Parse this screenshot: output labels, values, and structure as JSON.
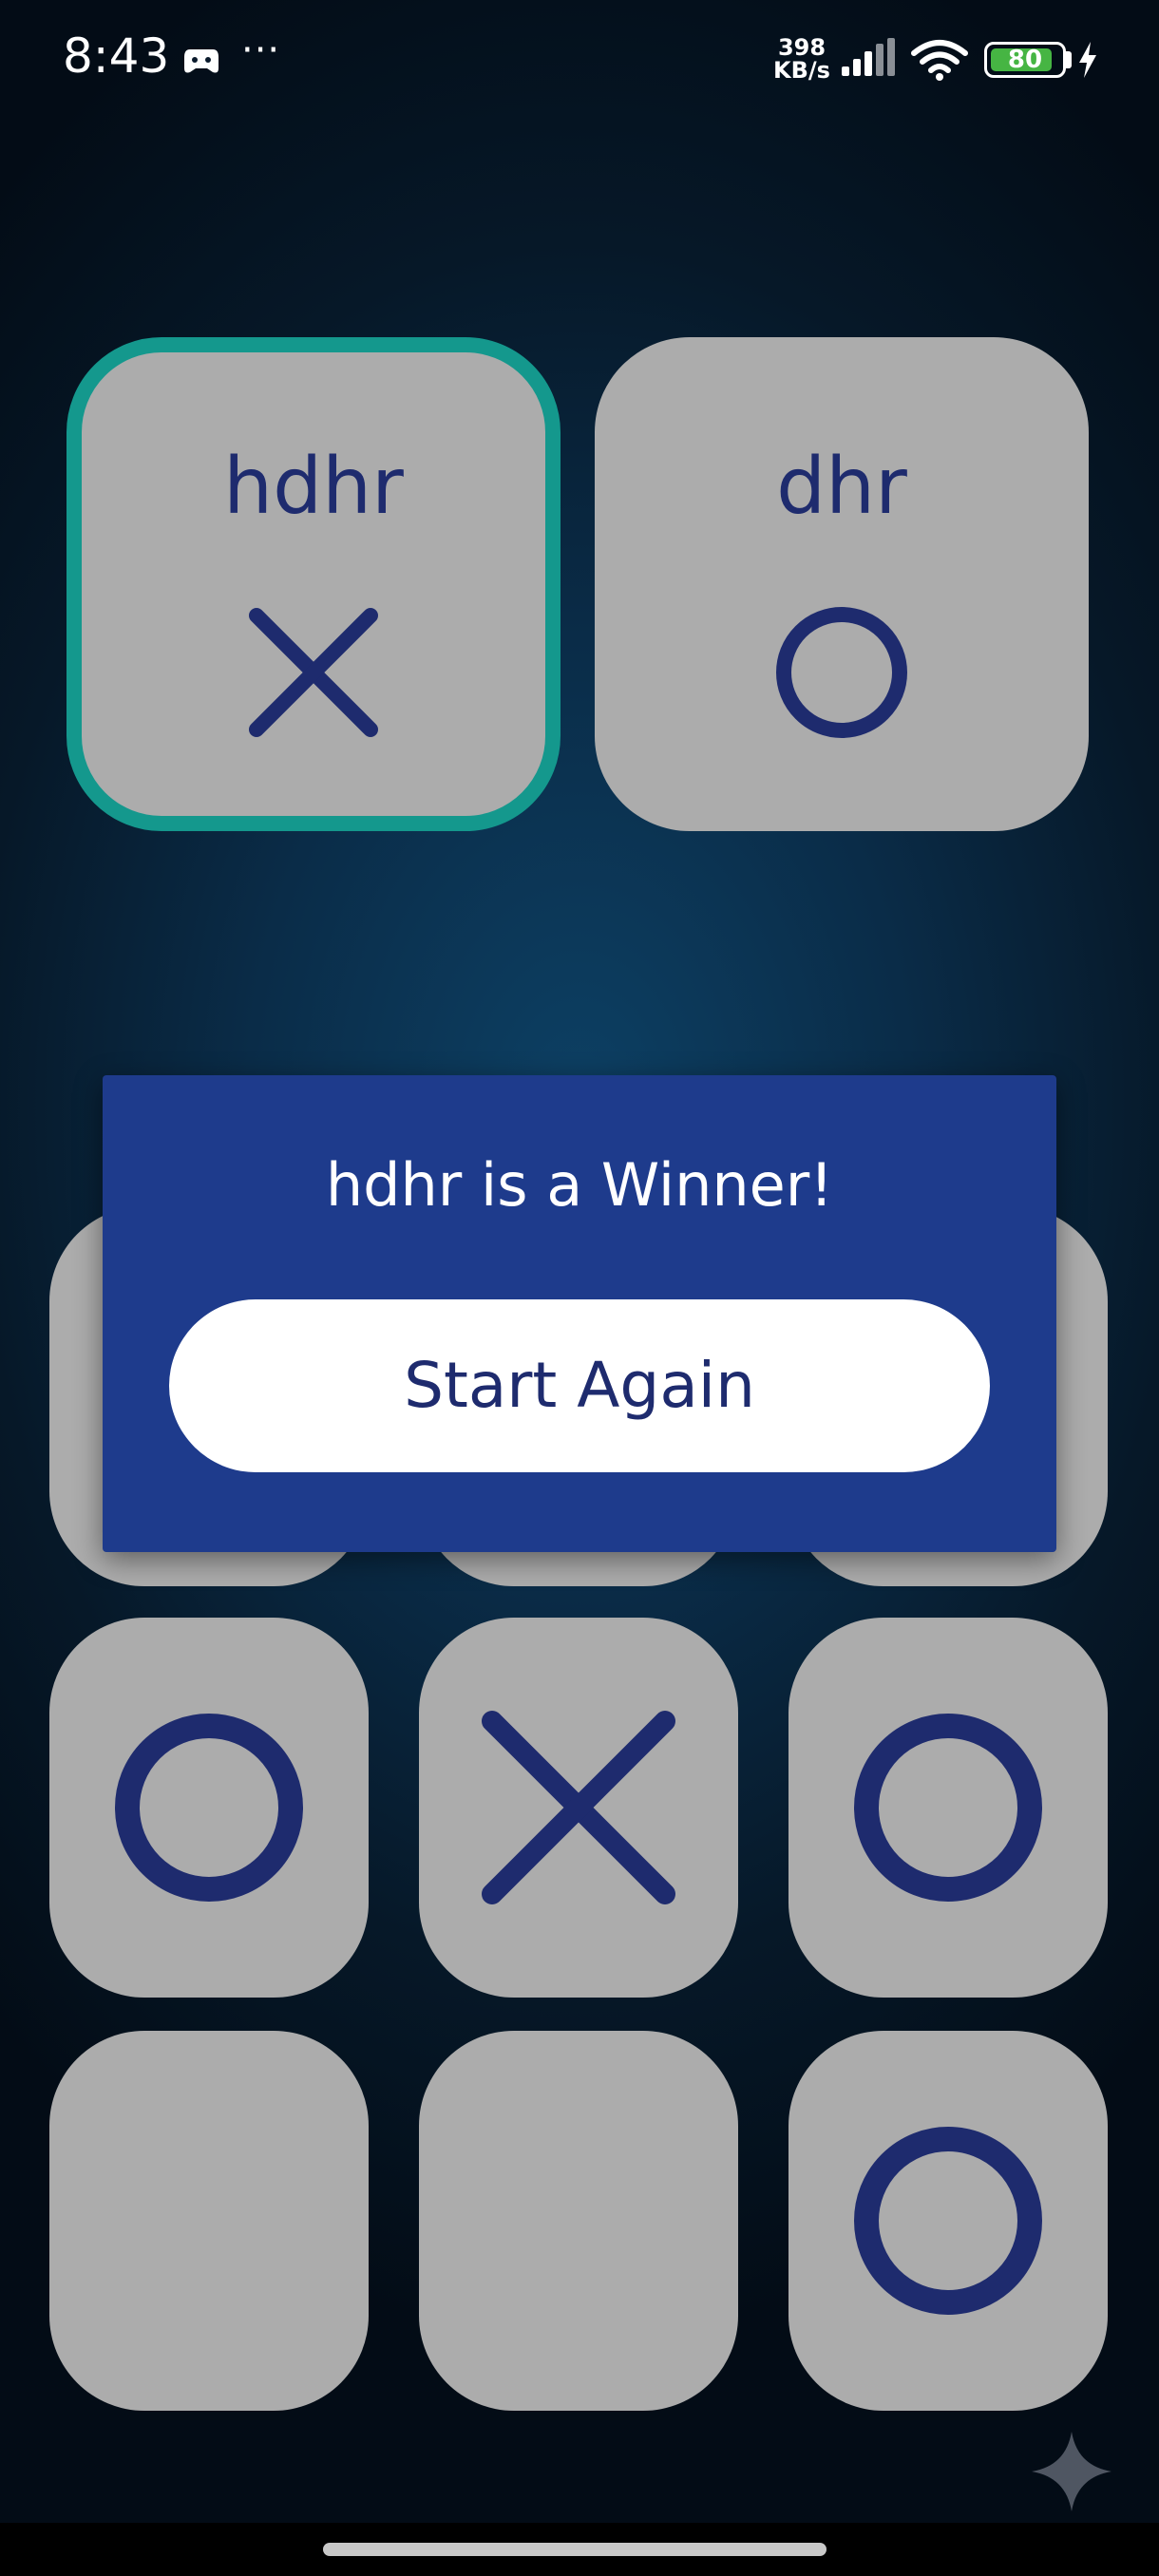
{
  "status_bar": {
    "time": "8:43",
    "more_dots": "···",
    "network_speed_value": "398",
    "network_speed_unit": "KB/s",
    "battery_level": "80",
    "icons": [
      "game-controller-icon",
      "signal-icon",
      "wifi-icon",
      "battery-icon",
      "charging-bolt-icon"
    ]
  },
  "players": [
    {
      "name": "hdhr",
      "mark": "X",
      "active": true
    },
    {
      "name": "dhr",
      "mark": "O",
      "active": false
    }
  ],
  "board": {
    "cells": [
      "",
      "",
      "",
      "O",
      "X",
      "O",
      "",
      "",
      "O"
    ]
  },
  "dialog": {
    "message": "hdhr is a Winner!",
    "button_label": "Start Again"
  },
  "colors": {
    "mark": "#1e2b6e",
    "card": "#acacac",
    "active_border": "#14988d",
    "dialog_bg": "#1e3b8c",
    "battery_fill": "#46b543"
  },
  "floating": {
    "icon": "sparkle-icon"
  }
}
